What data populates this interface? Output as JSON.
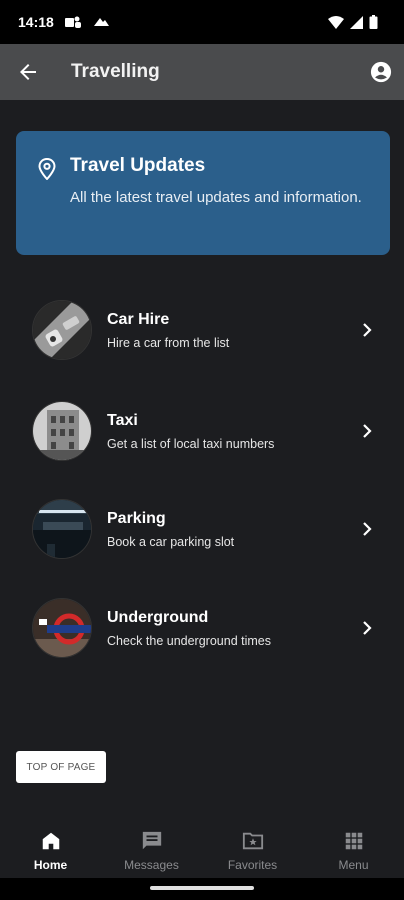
{
  "status_bar": {
    "time": "14:18",
    "icons": [
      "teams-icon",
      "cloud-icon",
      "wifi-icon",
      "signal-icon",
      "battery-icon"
    ]
  },
  "app_bar": {
    "title": "Travelling",
    "back_icon": "arrow-left-icon",
    "account_icon": "account-circle-icon"
  },
  "banner": {
    "title": "Travel Updates",
    "text": "All the latest travel updates and information.",
    "icon": "location-pin-icon",
    "color": "#2b5f8b"
  },
  "items": [
    {
      "title": "Car Hire",
      "subtitle": "Hire a car from the list"
    },
    {
      "title": "Taxi",
      "subtitle": "Get a list of local taxi numbers"
    },
    {
      "title": "Parking",
      "subtitle": "Book a car parking slot"
    },
    {
      "title": "Underground",
      "subtitle": "Check the underground times"
    }
  ],
  "top_button": {
    "label": "TOP OF PAGE"
  },
  "bottom_nav": [
    {
      "label": "Home",
      "icon": "home-icon",
      "active": true
    },
    {
      "label": "Messages",
      "icon": "message-icon",
      "active": false
    },
    {
      "label": "Favorites",
      "icon": "folder-star-icon",
      "active": false
    },
    {
      "label": "Menu",
      "icon": "grid-icon",
      "active": false
    }
  ],
  "colors": {
    "background": "#1c1d20",
    "app_bar": "#4a4b4d",
    "accent": "#2b5f8b"
  }
}
